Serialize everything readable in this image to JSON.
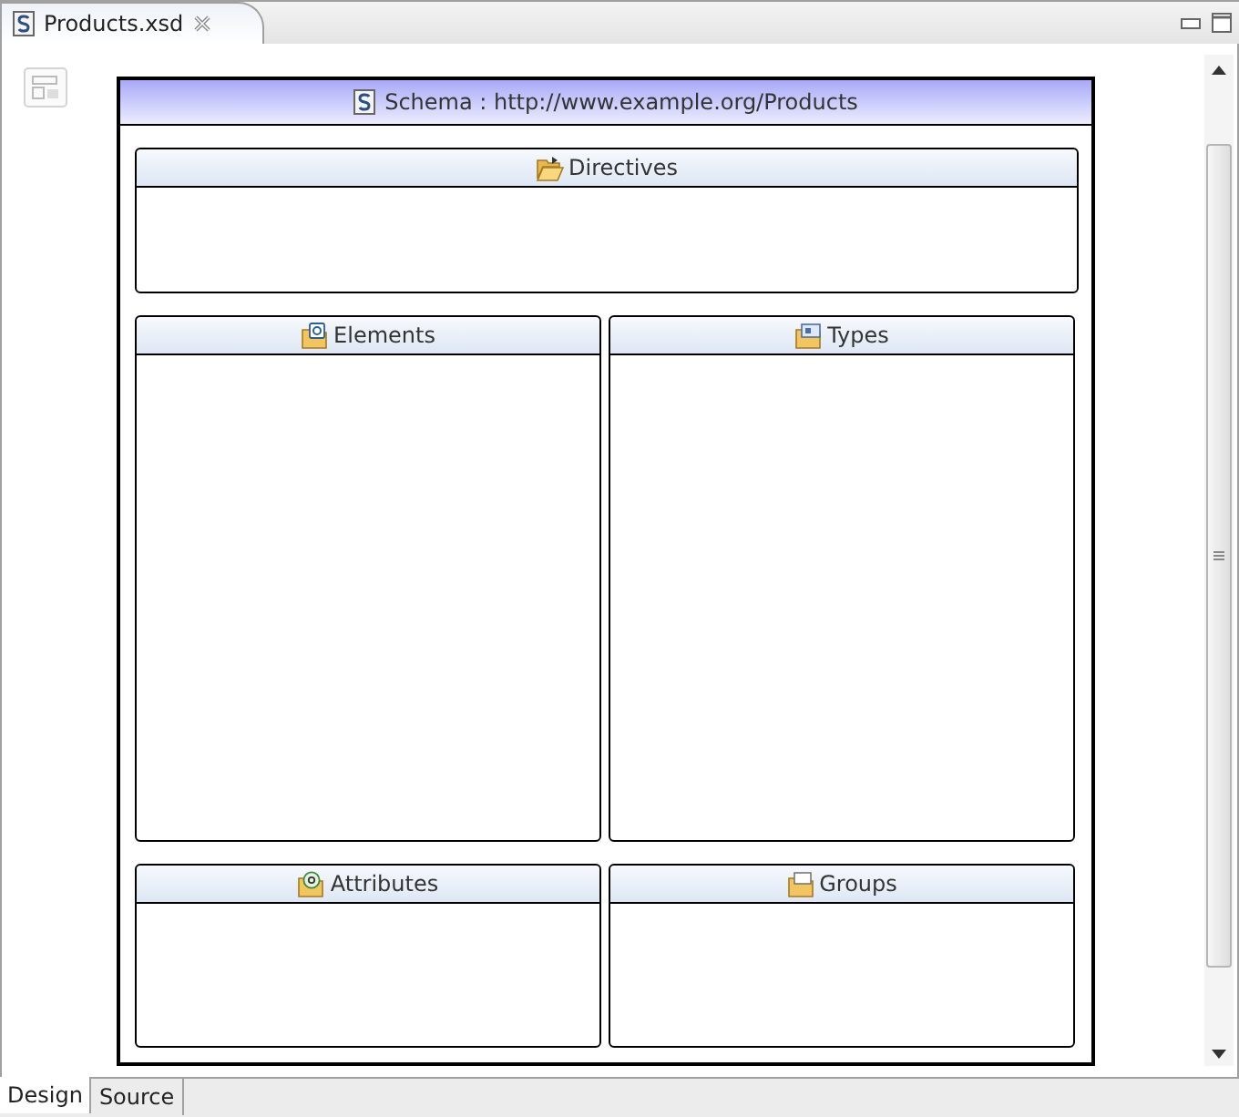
{
  "editor_tab": {
    "title": "Products.xsd"
  },
  "schema": {
    "title": "Schema : http://www.example.org/Products"
  },
  "section_rows": [
    [
      {
        "kind": "directives",
        "title": "Directives"
      }
    ],
    [
      {
        "kind": "elements",
        "title": "Elements"
      },
      {
        "kind": "types",
        "title": "Types"
      }
    ],
    [
      {
        "kind": "attributes",
        "title": "Attributes"
      },
      {
        "kind": "groups",
        "title": "Groups"
      }
    ]
  ],
  "bottom_tabs": [
    {
      "label": "Design",
      "selected": true
    },
    {
      "label": "Source",
      "selected": false
    }
  ]
}
